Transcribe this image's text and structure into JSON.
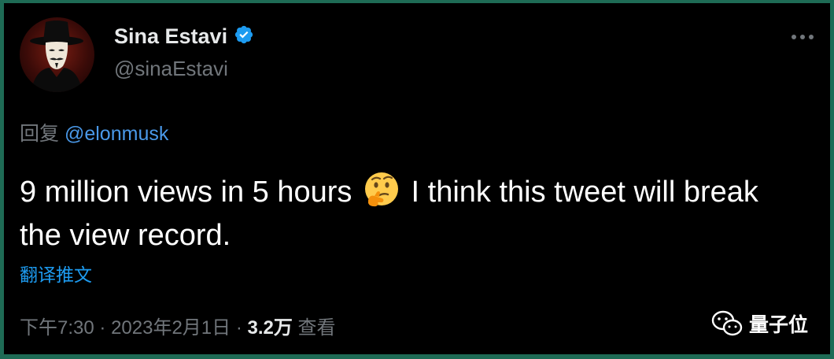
{
  "user": {
    "display_name": "Sina Estavi",
    "handle": "@sinaEstavi",
    "verified": true,
    "avatar_icon": "guy-fawkes-mask-avatar"
  },
  "reply": {
    "prefix": "回复",
    "mention": "@elonmusk"
  },
  "tweet": {
    "text_part1": "9 million views in 5 hours",
    "emoji": "thinking-face",
    "text_part2": "I think this tweet will break the view record."
  },
  "translate_label": "翻译推文",
  "meta": {
    "time": "下午7:30",
    "sep1": "·",
    "date": "2023年2月1日",
    "sep2": "·",
    "views_count": "3.2万",
    "views_label": "查看"
  },
  "more_icon": "more-horizontal-icon",
  "watermark": {
    "icon": "wechat-icon",
    "text": "量子位"
  },
  "colors": {
    "background": "#000000",
    "frame": "#1e6b55",
    "primary_text": "#e7e9ea",
    "secondary_text": "#71767b",
    "link": "#1d9bf0",
    "verified_badge": "#1d9bf0"
  }
}
